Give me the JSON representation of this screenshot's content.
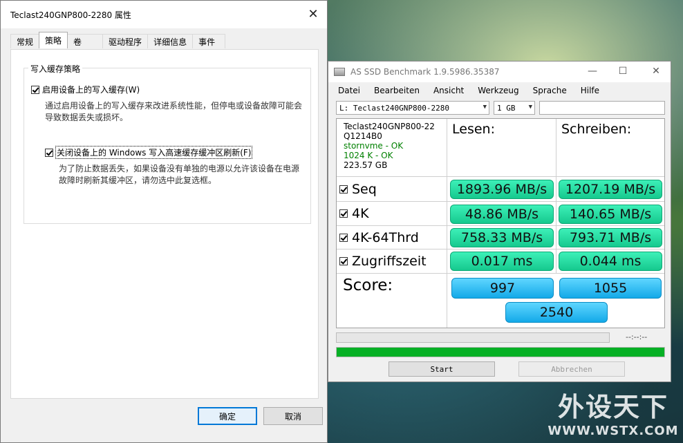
{
  "properties": {
    "title": "Teclast240GNP800-2280 属性",
    "tabs": [
      "常规",
      "策略",
      "卷",
      "驱动程序",
      "详细信息",
      "事件"
    ],
    "active_tab": "策略",
    "group_title": "写入缓存策略",
    "option1_label": "启用设备上的写入缓存(W)",
    "option1_checked": true,
    "option1_desc_line1": "通过启用设备上的写入缓存来改进系统性能，但停电或设备故障可能会",
    "option1_desc_line2": "导致数据丢失或损坏。",
    "option2_label": "关闭设备上的 Windows 写入高速缓存缓冲区刷新(F)",
    "option2_checked": true,
    "option2_desc_line1": "为了防止数据丢失，如果设备没有单独的电源以允许该设备在电源",
    "option2_desc_line2": "故障时刷新其缓冲区，请勿选中此复选框。",
    "ok_label": "确定",
    "cancel_label": "取消"
  },
  "asssd": {
    "title": "AS SSD Benchmark 1.9.5986.35387",
    "menu": [
      "Datei",
      "Bearbeiten",
      "Ansicht",
      "Werkzeug",
      "Sprache",
      "Hilfe"
    ],
    "drive_select": "L: Teclast240GNP800-2280",
    "size_select": "1 GB",
    "device": {
      "name": "Teclast240GNP800-22",
      "firmware": "Q1214B0",
      "driver": "stornvme - OK",
      "align": "1024 K - OK",
      "capacity": "223.57 GB"
    },
    "col_read": "Lesen:",
    "col_write": "Schreiben:",
    "rows": [
      {
        "label": "Seq",
        "read": "1893.96 MB/s",
        "write": "1207.19 MB/s"
      },
      {
        "label": "4K",
        "read": "48.86 MB/s",
        "write": "140.65 MB/s"
      },
      {
        "label": "4K-64Thrd",
        "read": "758.33 MB/s",
        "write": "793.71 MB/s"
      },
      {
        "label": "Zugriffszeit",
        "read": "0.017 ms",
        "write": "0.044 ms"
      }
    ],
    "score_label": "Score:",
    "score_read": "997",
    "score_write": "1055",
    "score_total": "2540",
    "timer": "--:--:--",
    "progress_fraction": 1.0,
    "start_label": "Start",
    "abort_label": "Abbrechen"
  },
  "watermark": {
    "cn": "外设天下",
    "url": "WWW.WSTX.COM"
  }
}
